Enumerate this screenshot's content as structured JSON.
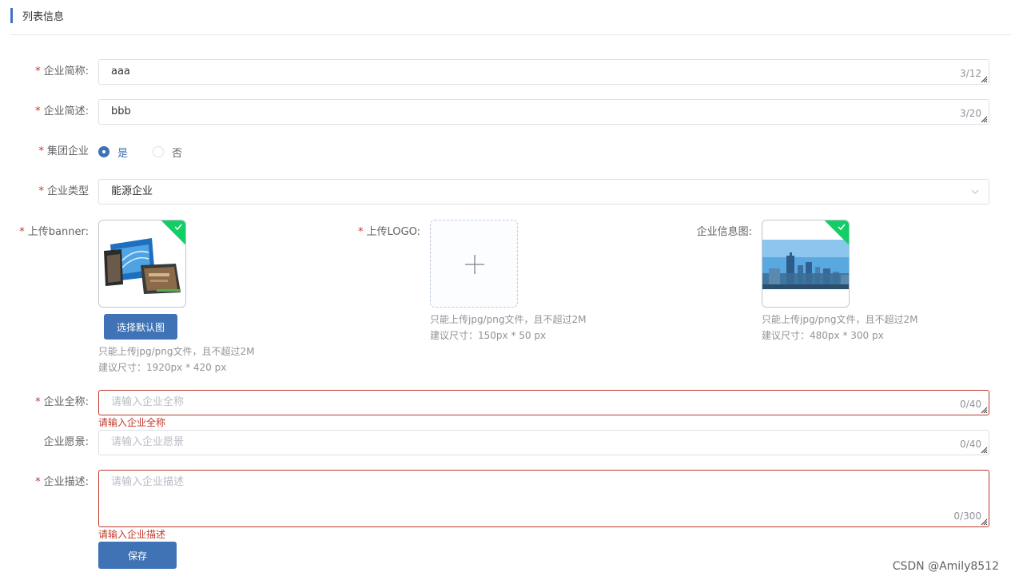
{
  "section": {
    "title": "列表信息"
  },
  "fields": {
    "short_name": {
      "required_mark": "*",
      "label": "企业简称:",
      "value": "aaa",
      "counter": "3/12"
    },
    "brief": {
      "required_mark": "*",
      "label": "企业简述:",
      "value": "bbb",
      "counter": "3/20"
    },
    "group": {
      "required_mark": "*",
      "label": "集团企业",
      "options": [
        {
          "label": "是",
          "selected": true
        },
        {
          "label": "否",
          "selected": false
        }
      ]
    },
    "type": {
      "required_mark": "*",
      "label": "企业类型",
      "value": "能源企业"
    },
    "banner": {
      "required_mark": "*",
      "label": "上传banner:",
      "button": "选择默认图",
      "hint1": "只能上传jpg/png文件，且不超过2M",
      "hint2": "建议尺寸：1920px * 420 px"
    },
    "logo": {
      "required_mark": "*",
      "label": "上传LOGO:",
      "hint1": "只能上传jpg/png文件，且不超过2M",
      "hint2": "建议尺寸：150px * 50 px"
    },
    "info_image": {
      "label": "企业信息图:",
      "hint1": "只能上传jpg/png文件，且不超过2M",
      "hint2": "建议尺寸：480px * 300 px"
    },
    "full_name": {
      "required_mark": "*",
      "label": "企业全称:",
      "placeholder": "请输入企业全称",
      "counter": "0/40",
      "error": "请输入企业全称"
    },
    "vision": {
      "label": "企业愿景:",
      "placeholder": "请输入企业愿景",
      "counter": "0/40"
    },
    "description": {
      "required_mark": "*",
      "label": "企业描述:",
      "placeholder": "请输入企业描述",
      "counter": "0/300",
      "error": "请输入企业描述"
    }
  },
  "save_button": "保存",
  "watermark": "CSDN @Amily8512",
  "colors": {
    "primary": "#3f73b5",
    "error": "#c0392b",
    "success": "#13ce66"
  },
  "icons": [
    "check-icon",
    "plus-icon",
    "chevron-down-icon",
    "resize-handle-icon"
  ]
}
